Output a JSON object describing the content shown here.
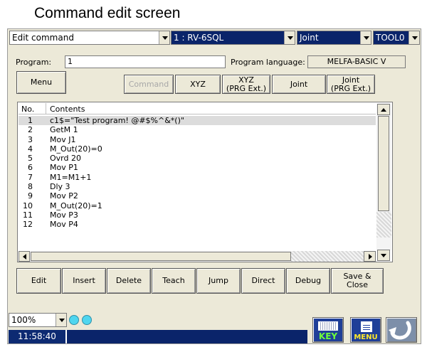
{
  "caption": "Command edit screen",
  "top_bar": {
    "mode_select": "Edit command",
    "robot_select": "1 : RV-6SQL",
    "jog_select": "Joint",
    "tool_select": "TOOL0"
  },
  "program_row": {
    "program_label": "Program:",
    "program_value": "1",
    "language_label": "Program language:",
    "language_value": "MELFA-BASIC V"
  },
  "toolbar": {
    "menu": "Menu",
    "command": "Command",
    "xyz": "XYZ",
    "xyz_prg": "XYZ\n(PRG Ext.)",
    "joint": "Joint",
    "joint_prg": "Joint\n(PRG Ext.)"
  },
  "list": {
    "headers": [
      "No.",
      "Contents"
    ],
    "rows": [
      {
        "no": "1",
        "content": "c1$=\"Test program! @#$%^&*()\""
      },
      {
        "no": "2",
        "content": "GetM 1"
      },
      {
        "no": "3",
        "content": "Mov J1"
      },
      {
        "no": "4",
        "content": "M_Out(20)=0"
      },
      {
        "no": "5",
        "content": "Ovrd 20"
      },
      {
        "no": "6",
        "content": "Mov P1"
      },
      {
        "no": "7",
        "content": "M1=M1+1"
      },
      {
        "no": "8",
        "content": "Dly 3"
      },
      {
        "no": "9",
        "content": "Mov P2"
      },
      {
        "no": "10",
        "content": "M_Out(20)=1"
      },
      {
        "no": "11",
        "content": "Mov P3"
      },
      {
        "no": "12",
        "content": "Mov P4"
      }
    ]
  },
  "actions": {
    "edit": "Edit",
    "insert": "Insert",
    "delete": "Delete",
    "teach": "Teach",
    "jump": "Jump",
    "direct": "Direct",
    "debug": "Debug",
    "save_close": "Save & Close"
  },
  "footer": {
    "zoom": "100%",
    "time": "11:58:40",
    "key_label": "KEY",
    "menu_label": "MENU"
  },
  "colors": {
    "panel": "#ece9d8",
    "selection": "#0a246a",
    "status_lights": "#4fd6ef"
  },
  "icons": [
    "dropdown-arrow-icon",
    "keyboard-icon",
    "menu-window-icon",
    "return-arrow-icon",
    "status-light-icon"
  ]
}
